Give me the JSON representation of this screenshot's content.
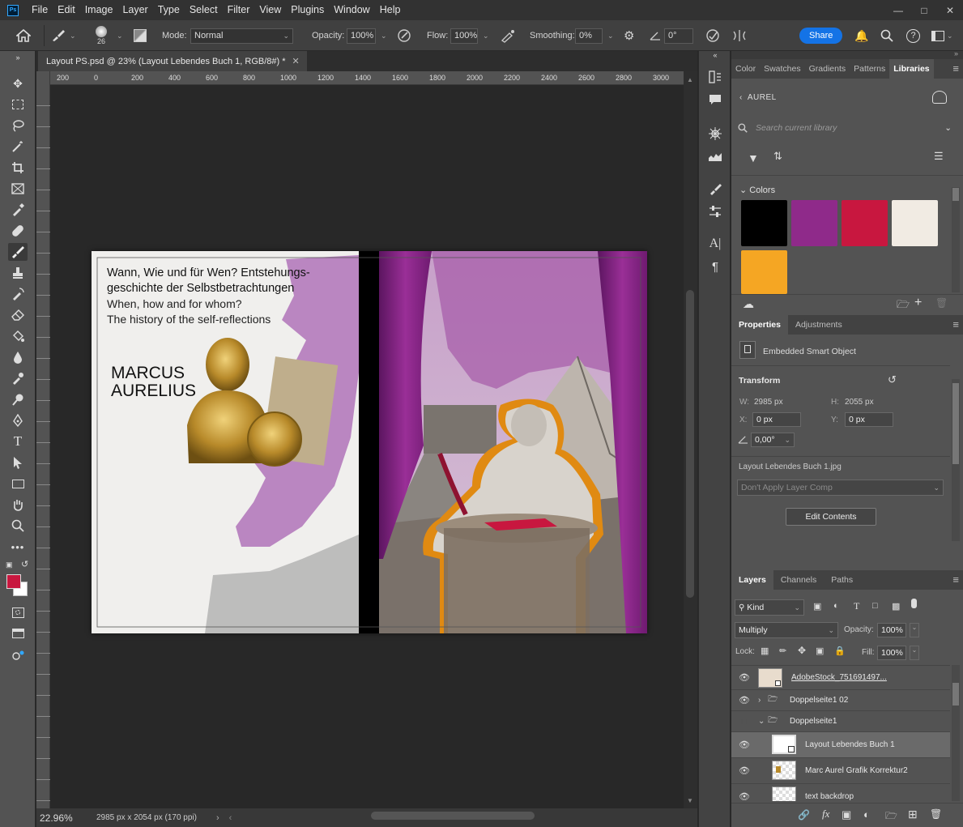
{
  "app": {
    "logo": "Ps"
  },
  "menu": [
    "File",
    "Edit",
    "Image",
    "Layer",
    "Type",
    "Select",
    "Filter",
    "View",
    "Plugins",
    "Window",
    "Help"
  ],
  "options": {
    "brush_size": "26",
    "mode_label": "Mode:",
    "mode_value": "Normal",
    "opacity_label": "Opacity:",
    "opacity_value": "100%",
    "flow_label": "Flow:",
    "flow_value": "100%",
    "smoothing_label": "Smoothing:",
    "smoothing_value": "0%",
    "angle_value": "0°",
    "share_label": "Share"
  },
  "document": {
    "tab_title": "Layout PS.psd @ 23% (Layout Lebendes Buch 1, RGB/8#) *",
    "ruler_ticks": [
      "200",
      "0",
      "200",
      "400",
      "600",
      "800",
      "1000",
      "1200",
      "1400",
      "1600",
      "1800",
      "2000",
      "2200",
      "2400",
      "2600",
      "2800",
      "3000"
    ],
    "zoom": "22.96%",
    "doc_info": "2985 px x 2054 px (170 ppi)"
  },
  "artwork": {
    "heading_de_1": "Wann, Wie und für Wen? Entstehungs-",
    "heading_de_2": "geschichte der Selbstbetrachtungen",
    "heading_en_1": "When, how and for whom?",
    "heading_en_2": "The history of the self-reflections",
    "name_1": "MARCUS",
    "name_2": "AURELIUS"
  },
  "libraries": {
    "tabs": [
      "Color",
      "Swatches",
      "Gradients",
      "Patterns",
      "Libraries"
    ],
    "active_tab": "Libraries",
    "library_name": "AUREL",
    "search_placeholder": "Search current library",
    "colors_heading": "Colors",
    "colors": [
      "#000000",
      "#8f2a8a",
      "#c8173f",
      "#f1ebe3",
      "#f5a623"
    ]
  },
  "properties": {
    "tabs": [
      "Properties",
      "Adjustments"
    ],
    "type_label": "Embedded Smart Object",
    "transform_heading": "Transform",
    "w_label": "W:",
    "w_value": "2985 px",
    "h_label": "H:",
    "h_value": "2055 px",
    "x_label": "X:",
    "x_value": "0 px",
    "y_label": "Y:",
    "y_value": "0 px",
    "angle_value": "0,00°",
    "file_name": "Layout Lebendes Buch 1.jpg",
    "layer_comp": "Don't Apply Layer Comp",
    "edit_button": "Edit Contents"
  },
  "layers": {
    "tabs": [
      "Layers",
      "Channels",
      "Paths"
    ],
    "filter_kind": "Kind",
    "blend_mode": "Multiply",
    "opacity_label": "Opacity:",
    "opacity_value": "100%",
    "lock_label": "Lock:",
    "fill_label": "Fill:",
    "fill_value": "100%",
    "items": [
      {
        "name": "AdobeStock_751691497..."
      },
      {
        "name": "Doppelseite1 02"
      },
      {
        "name": "Doppelseite1"
      },
      {
        "name": "Layout Lebendes Buch 1"
      },
      {
        "name": "Marc Aurel Grafik Korrektur2"
      },
      {
        "name": "text backdrop"
      }
    ]
  },
  "colors": {
    "foreground": "#c8173f",
    "background": "#ffffff",
    "accent": "#1473e6"
  }
}
